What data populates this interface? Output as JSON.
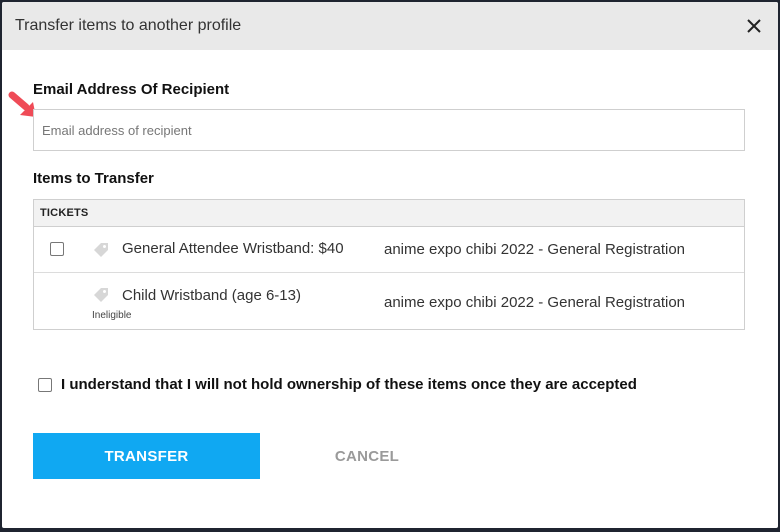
{
  "dialog": {
    "title": "Transfer items to another profile",
    "close_icon": "close-icon"
  },
  "email": {
    "label": "Email Address Of Recipient",
    "placeholder": "Email address of recipient",
    "value": ""
  },
  "items": {
    "label": "Items to Transfer",
    "table_header": "TICKETS",
    "rows": [
      {
        "ticket": "General Attendee Wristband: $40",
        "event": "anime expo chibi 2022 - General Registration",
        "selectable": true,
        "checked": false,
        "note": ""
      },
      {
        "ticket": "Child Wristband (age 6-13)",
        "event": "anime expo chibi 2022 - General Registration",
        "selectable": false,
        "note": "Ineligible"
      }
    ]
  },
  "agreement": {
    "label": "I understand that I will not hold ownership of these items once they are accepted",
    "checked": false
  },
  "actions": {
    "transfer": "TRANSFER",
    "cancel": "CANCEL"
  },
  "colors": {
    "primary": "#10a8f2",
    "header_bg": "#e9e9e9",
    "annotation_arrow": "#ef4b57"
  }
}
